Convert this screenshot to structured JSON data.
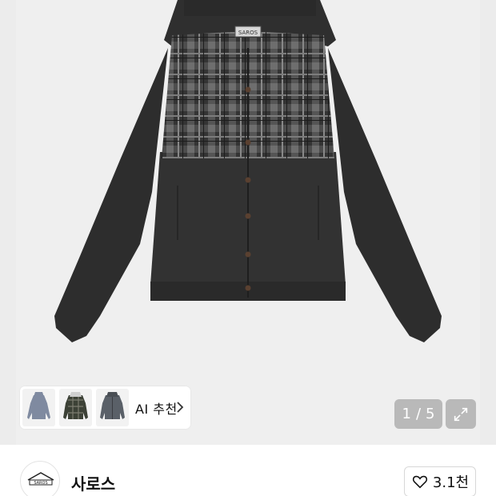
{
  "gallery": {
    "pager_current": "1",
    "pager_separator": "/",
    "pager_total": "5",
    "icon_expand": "expand-icon"
  },
  "ai_recommend": {
    "label": "AI 추천",
    "thumbnails": [
      "grey-hooded-jacket",
      "plaid-hooded-shirt",
      "grey-hooded-work-jacket"
    ],
    "icon_chevron": "chevron-right-icon"
  },
  "store": {
    "name": "사로스",
    "logo_text": "SAROS",
    "like_count": "3.1천",
    "icon_like": "heart-icon"
  },
  "colors": {
    "background": "#ececec",
    "jacket": "#2f2f2f",
    "plaid": "#5a5a5a"
  }
}
